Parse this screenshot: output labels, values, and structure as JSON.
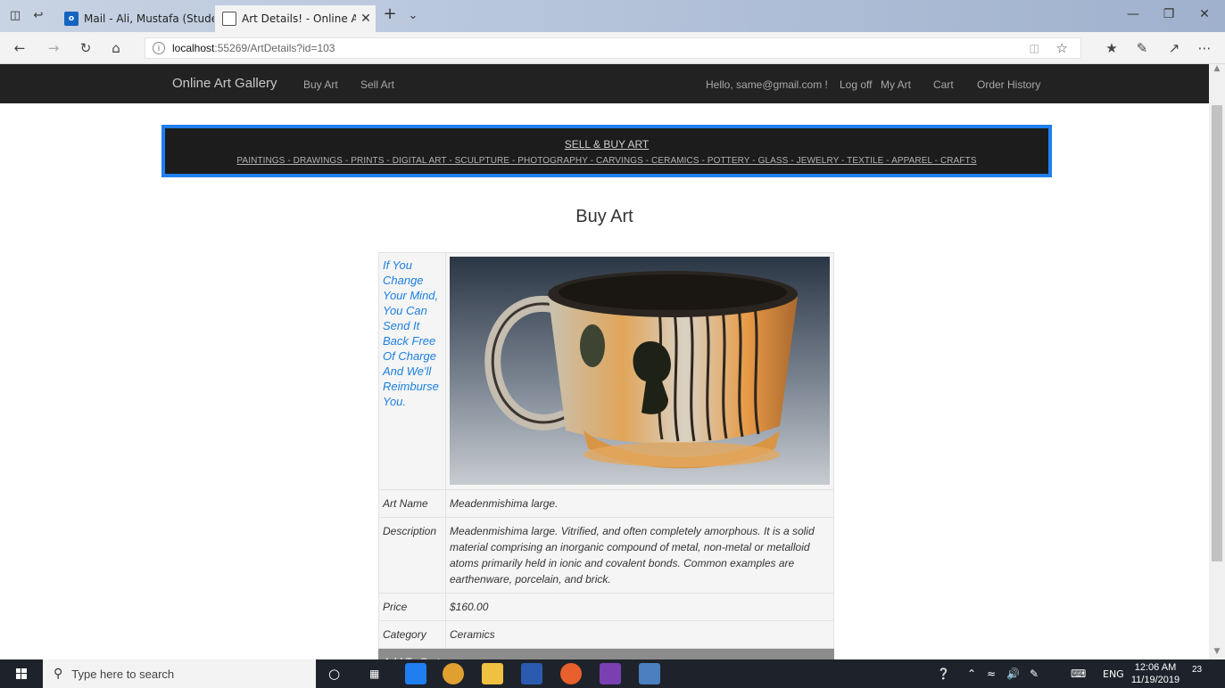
{
  "browser": {
    "tabs": [
      {
        "title": "Mail - Ali, Mustafa (Student)",
        "active": false
      },
      {
        "title": "Art Details! - Online Art",
        "active": true
      }
    ],
    "url_host": "localhost",
    "url_path": ":55269/ArtDetails?id=103"
  },
  "site_nav": {
    "brand": "Online Art Gallery",
    "left_links": [
      "Buy Art",
      "Sell Art"
    ],
    "greeting": "Hello, same@gmail.com !",
    "right_links": [
      "Log off",
      "My Art",
      "Cart",
      "Order History"
    ]
  },
  "banner": {
    "title": "SELL & BUY ART",
    "categories": "PAINTINGS - DRAWINGS - PRINTS - DIGITAL ART - SCULPTURE - PHOTOGRAPHY - CARVINGS - CERAMICS - POTTERY - GLASS - JEWELRY - TEXTILE - APPAREL - CRAFTS"
  },
  "page": {
    "title": "Buy Art",
    "promo": "If You Change Your Mind, You Can Send It Back Free Of Charge And We'll Reimburse You.",
    "details": {
      "art_name_label": "Art Name",
      "art_name": "Meadenmishima large.",
      "description_label": "Description",
      "description": "Meadenmishima large. Vitrified, and often completely amorphous. It is a solid material comprising an inorganic compound of metal, non-metal or metalloid atoms primarily held in ionic and covalent bonds. Common examples are earthenware, porcelain, and brick.",
      "price_label": "Price",
      "price": "$160.00",
      "category_label": "Category",
      "category": "Ceramics"
    },
    "add_to_cart": "Add To Cart"
  },
  "taskbar": {
    "search_placeholder": "Type here to search",
    "language": "ENG",
    "time": "12:06 AM",
    "date": "11/19/2019",
    "notification_count": "23"
  },
  "colors": {
    "site_nav_bg": "#222222",
    "banner_border": "#1f7ff0",
    "promo_text": "#1c7fe0",
    "add_to_cart_bg": "#8c8c8c"
  }
}
